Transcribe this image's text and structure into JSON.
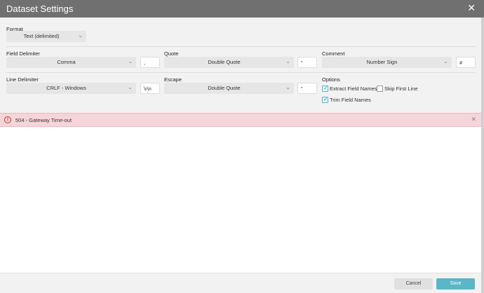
{
  "dialog": {
    "title": "Dataset Settings"
  },
  "format": {
    "label": "Format",
    "value": "Text (delimited)"
  },
  "field_delimiter": {
    "label": "Field Delimiter",
    "value": "Comma",
    "custom": ","
  },
  "quote": {
    "label": "Quote",
    "value": "Double Quote",
    "custom": "\""
  },
  "comment": {
    "label": "Comment",
    "value": "Number Sign",
    "custom": "#"
  },
  "line_delimiter": {
    "label": "Line Delimiter",
    "value": "CRLF - Windows",
    "custom": "\\r\\n"
  },
  "escape": {
    "label": "Escape",
    "value": "Double Quote",
    "custom": "\""
  },
  "options": {
    "label": "Options",
    "extract_field_names": {
      "label": "Extract Field Names",
      "checked": true
    },
    "skip_first_line": {
      "label": "Skip First Line",
      "checked": false
    },
    "trim_field_names": {
      "label": "Trim Field Names",
      "checked": true
    }
  },
  "error": {
    "message": "504 - Gateway Time-out"
  },
  "footer": {
    "cancel_label": "Cancel",
    "save_label": "Save"
  },
  "icons": {
    "close": "close-icon",
    "error": "error-icon",
    "chevron": "chevron-down-icon"
  },
  "colors": {
    "accent": "#5ab7c7",
    "titlebar": "#707070",
    "error_bg": "#f6d5d8"
  }
}
